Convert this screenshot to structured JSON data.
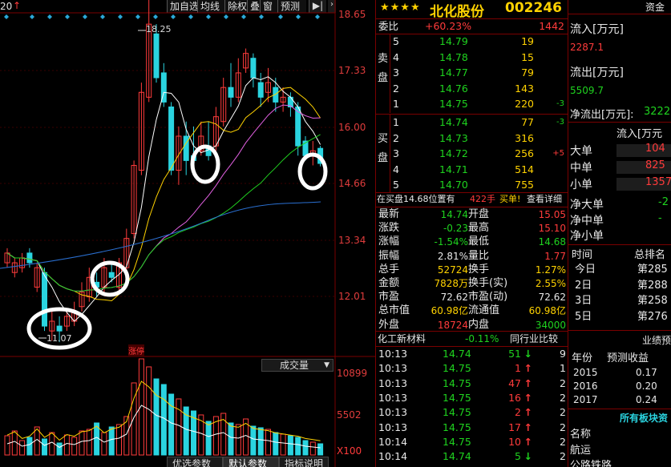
{
  "chart": {
    "prev_label": "20",
    "toolbar": [
      "加自选",
      "均线",
      "除权",
      "叠",
      "窗",
      "预测"
    ],
    "price_labels": [
      "18.65",
      "17.33",
      "16.00",
      "14.66",
      "13.34",
      "12.01"
    ],
    "high_marker": "18.25",
    "low_marker": "11.07",
    "zhangting_tag": "涨停",
    "volume_selector": "成交量",
    "volume_labels": [
      "10899",
      "5502",
      "X100"
    ],
    "bottom_tabs": [
      "优选参数",
      "默认参数",
      "指标说明"
    ]
  },
  "chart_data": {
    "type": "candlestick",
    "title": "北化股份 002246",
    "y_axis_ticks": [
      18.65,
      17.33,
      16.0,
      14.66,
      13.34,
      12.01
    ],
    "price_high": 18.25,
    "price_low": 11.07,
    "volume_axis_ticks": [
      10899,
      5502
    ],
    "volume_unit": "X100"
  },
  "header": {
    "stars": "★★★★",
    "name": "北化股份",
    "code": "002246"
  },
  "weibi": {
    "label": "委比",
    "pct": "+60.23%",
    "diff": "1442"
  },
  "sell": {
    "label": "卖盘",
    "rows": [
      {
        "lvl": "5",
        "price": "14.79",
        "vol": "19",
        "chg": ""
      },
      {
        "lvl": "4",
        "price": "14.78",
        "vol": "15",
        "chg": ""
      },
      {
        "lvl": "3",
        "price": "14.77",
        "vol": "79",
        "chg": ""
      },
      {
        "lvl": "2",
        "price": "14.76",
        "vol": "143",
        "chg": ""
      },
      {
        "lvl": "1",
        "price": "14.75",
        "vol": "220",
        "chg": "-3"
      }
    ]
  },
  "buy": {
    "label": "买盘",
    "rows": [
      {
        "lvl": "1",
        "price": "14.74",
        "vol": "77",
        "chg": "-3"
      },
      {
        "lvl": "2",
        "price": "14.73",
        "vol": "316",
        "chg": ""
      },
      {
        "lvl": "3",
        "price": "14.72",
        "vol": "256",
        "chg": "+5"
      },
      {
        "lvl": "4",
        "price": "14.71",
        "vol": "514",
        "chg": ""
      },
      {
        "lvl": "5",
        "price": "14.70",
        "vol": "755",
        "chg": ""
      }
    ]
  },
  "notice": {
    "text": "在买盘14.68位置有",
    "qty": "422手",
    "action": "买单!",
    "link": "查看详细"
  },
  "stats": [
    {
      "l1": "最新",
      "v1": "14.74",
      "c1": "grn",
      "l2": "开盘",
      "v2": "15.05",
      "c2": "red"
    },
    {
      "l1": "涨跌",
      "v1": "-0.23",
      "c1": "grn",
      "l2": "最高",
      "v2": "15.10",
      "c2": "red"
    },
    {
      "l1": "涨幅",
      "v1": "-1.54%",
      "c1": "grn",
      "l2": "最低",
      "v2": "14.68",
      "c2": "grn"
    },
    {
      "l1": "振幅",
      "v1": "2.81%",
      "c1": "wht",
      "l2": "量比",
      "v2": "1.77",
      "c2": "red"
    },
    {
      "l1": "总手",
      "v1": "52724",
      "c1": "yel",
      "l2": "换手",
      "v2": "1.27%",
      "c2": "yel"
    },
    {
      "l1": "金额",
      "v1": "7828万",
      "c1": "yel",
      "l2": "换手(实)",
      "v2": "2.55%",
      "c2": "yel"
    },
    {
      "l1": "市盈",
      "v1": "72.62",
      "c1": "wht",
      "l2": "市盈(动)",
      "v2": "72.62",
      "c2": "wht"
    },
    {
      "l1": "总市值",
      "v1": "60.98亿",
      "c1": "yel",
      "l2": "流通值",
      "v2": "60.98亿",
      "c2": "yel"
    },
    {
      "l1": "外盘",
      "v1": "18724",
      "c1": "red",
      "l2": "内盘",
      "v2": "34000",
      "c2": "grn"
    }
  ],
  "sector": {
    "name": "化工新材料",
    "pct": "-0.11%",
    "compare": "同行业比较"
  },
  "ticks": [
    {
      "t": "10:13",
      "p": "14.74",
      "pc": "grn",
      "v": "51",
      "d": "down",
      "n": "9"
    },
    {
      "t": "10:13",
      "p": "14.75",
      "pc": "grn",
      "v": "1",
      "d": "up",
      "n": "1"
    },
    {
      "t": "10:13",
      "p": "14.75",
      "pc": "grn",
      "v": "47",
      "d": "up",
      "n": "2"
    },
    {
      "t": "10:13",
      "p": "14.75",
      "pc": "grn",
      "v": "16",
      "d": "up",
      "n": "2"
    },
    {
      "t": "10:13",
      "p": "14.75",
      "pc": "grn",
      "v": "2",
      "d": "up",
      "n": "2"
    },
    {
      "t": "10:13",
      "p": "14.75",
      "pc": "grn",
      "v": "17",
      "d": "up",
      "n": "2"
    },
    {
      "t": "10:14",
      "p": "14.75",
      "pc": "grn",
      "v": "10",
      "d": "up",
      "n": "2"
    },
    {
      "t": "10:14",
      "p": "14.74",
      "pc": "grn",
      "v": "5",
      "d": "down",
      "n": "2"
    }
  ],
  "right": {
    "top_label": "资金",
    "flow_in_label": "流入[万元]",
    "flow_in_val": "2287.1",
    "flow_out_label": "流出[万元]",
    "flow_out_val": "5509.7",
    "net_label": "净流出[万元]:",
    "net_val": "3222.",
    "table_header": "流入[万元",
    "orders": [
      {
        "label": "大单",
        "val": "104"
      },
      {
        "label": "中单",
        "val": "825"
      },
      {
        "label": "小单",
        "val": "1357"
      }
    ],
    "net_rows": [
      {
        "label": "净大单",
        "val": "-2"
      },
      {
        "label": "净中单",
        "val": "-"
      },
      {
        "label": "净小单",
        "val": ""
      }
    ],
    "rank_head": {
      "c1": "时间",
      "c2": "总排名"
    },
    "ranks": [
      {
        "d": "今日",
        "r": "第285"
      },
      {
        "d": "2日",
        "r": "第288"
      },
      {
        "d": "3日",
        "r": "第258"
      },
      {
        "d": "5日",
        "r": "第276"
      }
    ],
    "perf_title": "业绩预",
    "perf_head": {
      "c1": "年份",
      "c2": "预测收益"
    },
    "perf": [
      {
        "y": "2015",
        "v": "0.17"
      },
      {
        "y": "2016",
        "v": "0.20"
      },
      {
        "y": "2017",
        "v": "0.24"
      }
    ],
    "blocks_title": "所有板块资",
    "blocks_head": "名称",
    "blocks": [
      "航运",
      "公路铁路"
    ]
  },
  "colors": {
    "up": "#ff3b3b",
    "down": "#1fd31f",
    "border": "#7a0000",
    "accent": "#ffd200"
  }
}
